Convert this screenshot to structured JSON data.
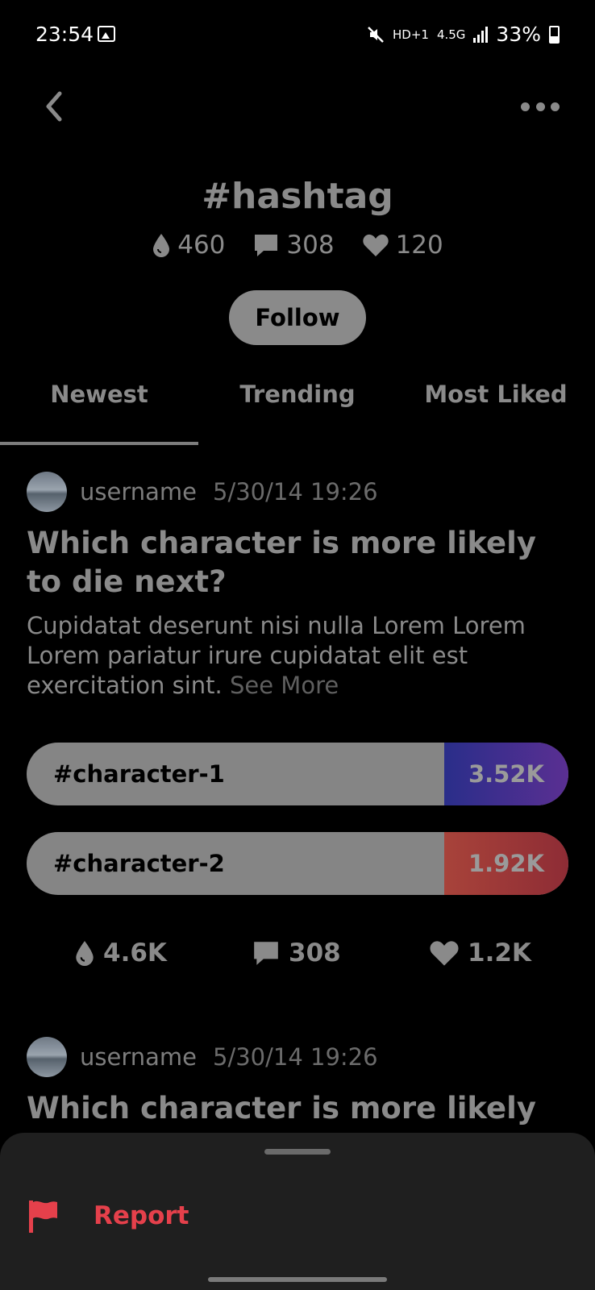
{
  "status_bar": {
    "time": "23:54",
    "network": "HD+1",
    "signal": "4.5G",
    "battery": "33%"
  },
  "header": {
    "title": "#hashtag"
  },
  "stats": {
    "drops": "460",
    "comments": "308",
    "likes": "120"
  },
  "follow_label": "Follow",
  "tabs": [
    {
      "label": "Newest",
      "active": true
    },
    {
      "label": "Trending",
      "active": false
    },
    {
      "label": "Most Liked",
      "active": false
    }
  ],
  "posts": [
    {
      "username": "username",
      "date": "5/30/14 19:26",
      "title": "Which character is more likely to die next?",
      "body": "Cupidatat deserunt nisi nulla Lorem Lorem Lorem pariatur irure cupidatat elit est exercitation sint.",
      "see_more": "See More",
      "options": [
        {
          "label": "#character-1",
          "votes": "3.52K",
          "color_from": "#2a2e8a",
          "color_to": "#5a2f92"
        },
        {
          "label": "#character-2",
          "votes": "1.92K",
          "color_from": "#a8433a",
          "color_to": "#8e2c35"
        }
      ],
      "actions": {
        "drops": "4.6K",
        "comments": "308",
        "likes": "1.2K"
      }
    },
    {
      "username": "username",
      "date": "5/30/14 19:26",
      "title": "Which character is more likely to"
    }
  ],
  "sheet": {
    "report_label": "Report",
    "report_color": "#e5404b"
  }
}
